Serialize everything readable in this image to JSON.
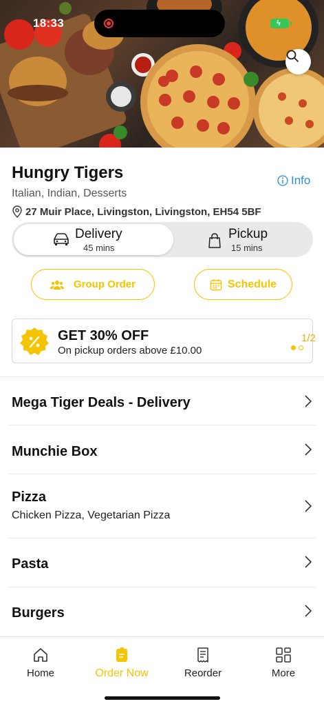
{
  "status_bar": {
    "time": "18:33"
  },
  "hero": {
    "search_icon": "search-icon"
  },
  "restaurant": {
    "name": "Hungry Tigers",
    "cuisines": "Italian, Indian, Desserts",
    "info_label": "Info",
    "address": "27 Muir Place, Livingston, Livingston, EH54 5BF"
  },
  "order_type": {
    "delivery": {
      "label": "Delivery",
      "time": "45 mins",
      "selected": true
    },
    "pickup": {
      "label": "Pickup",
      "time": "15 mins",
      "selected": false
    }
  },
  "actions": {
    "group_order": "Group Order",
    "schedule": "Schedule"
  },
  "promo": {
    "title": "GET 30% OFF",
    "subtitle": "On pickup orders above £10.00",
    "counter": "1/2"
  },
  "categories": [
    {
      "title": "Mega Tiger Deals - Delivery",
      "subtitle": ""
    },
    {
      "title": "Munchie Box",
      "subtitle": ""
    },
    {
      "title": "Pizza",
      "subtitle": "Chicken Pizza, Vegetarian Pizza"
    },
    {
      "title": "Pasta",
      "subtitle": ""
    },
    {
      "title": "Burgers",
      "subtitle": ""
    }
  ],
  "bottom_nav": [
    {
      "label": "Home",
      "icon": "home-icon",
      "active": false
    },
    {
      "label": "Order Now",
      "icon": "order-icon",
      "active": true
    },
    {
      "label": "Reorder",
      "icon": "receipt-icon",
      "active": false
    },
    {
      "label": "More",
      "icon": "grid-icon",
      "active": false
    }
  ],
  "colors": {
    "accent": "#f5c400",
    "link": "#2a8fd6",
    "battery": "#35c759"
  }
}
